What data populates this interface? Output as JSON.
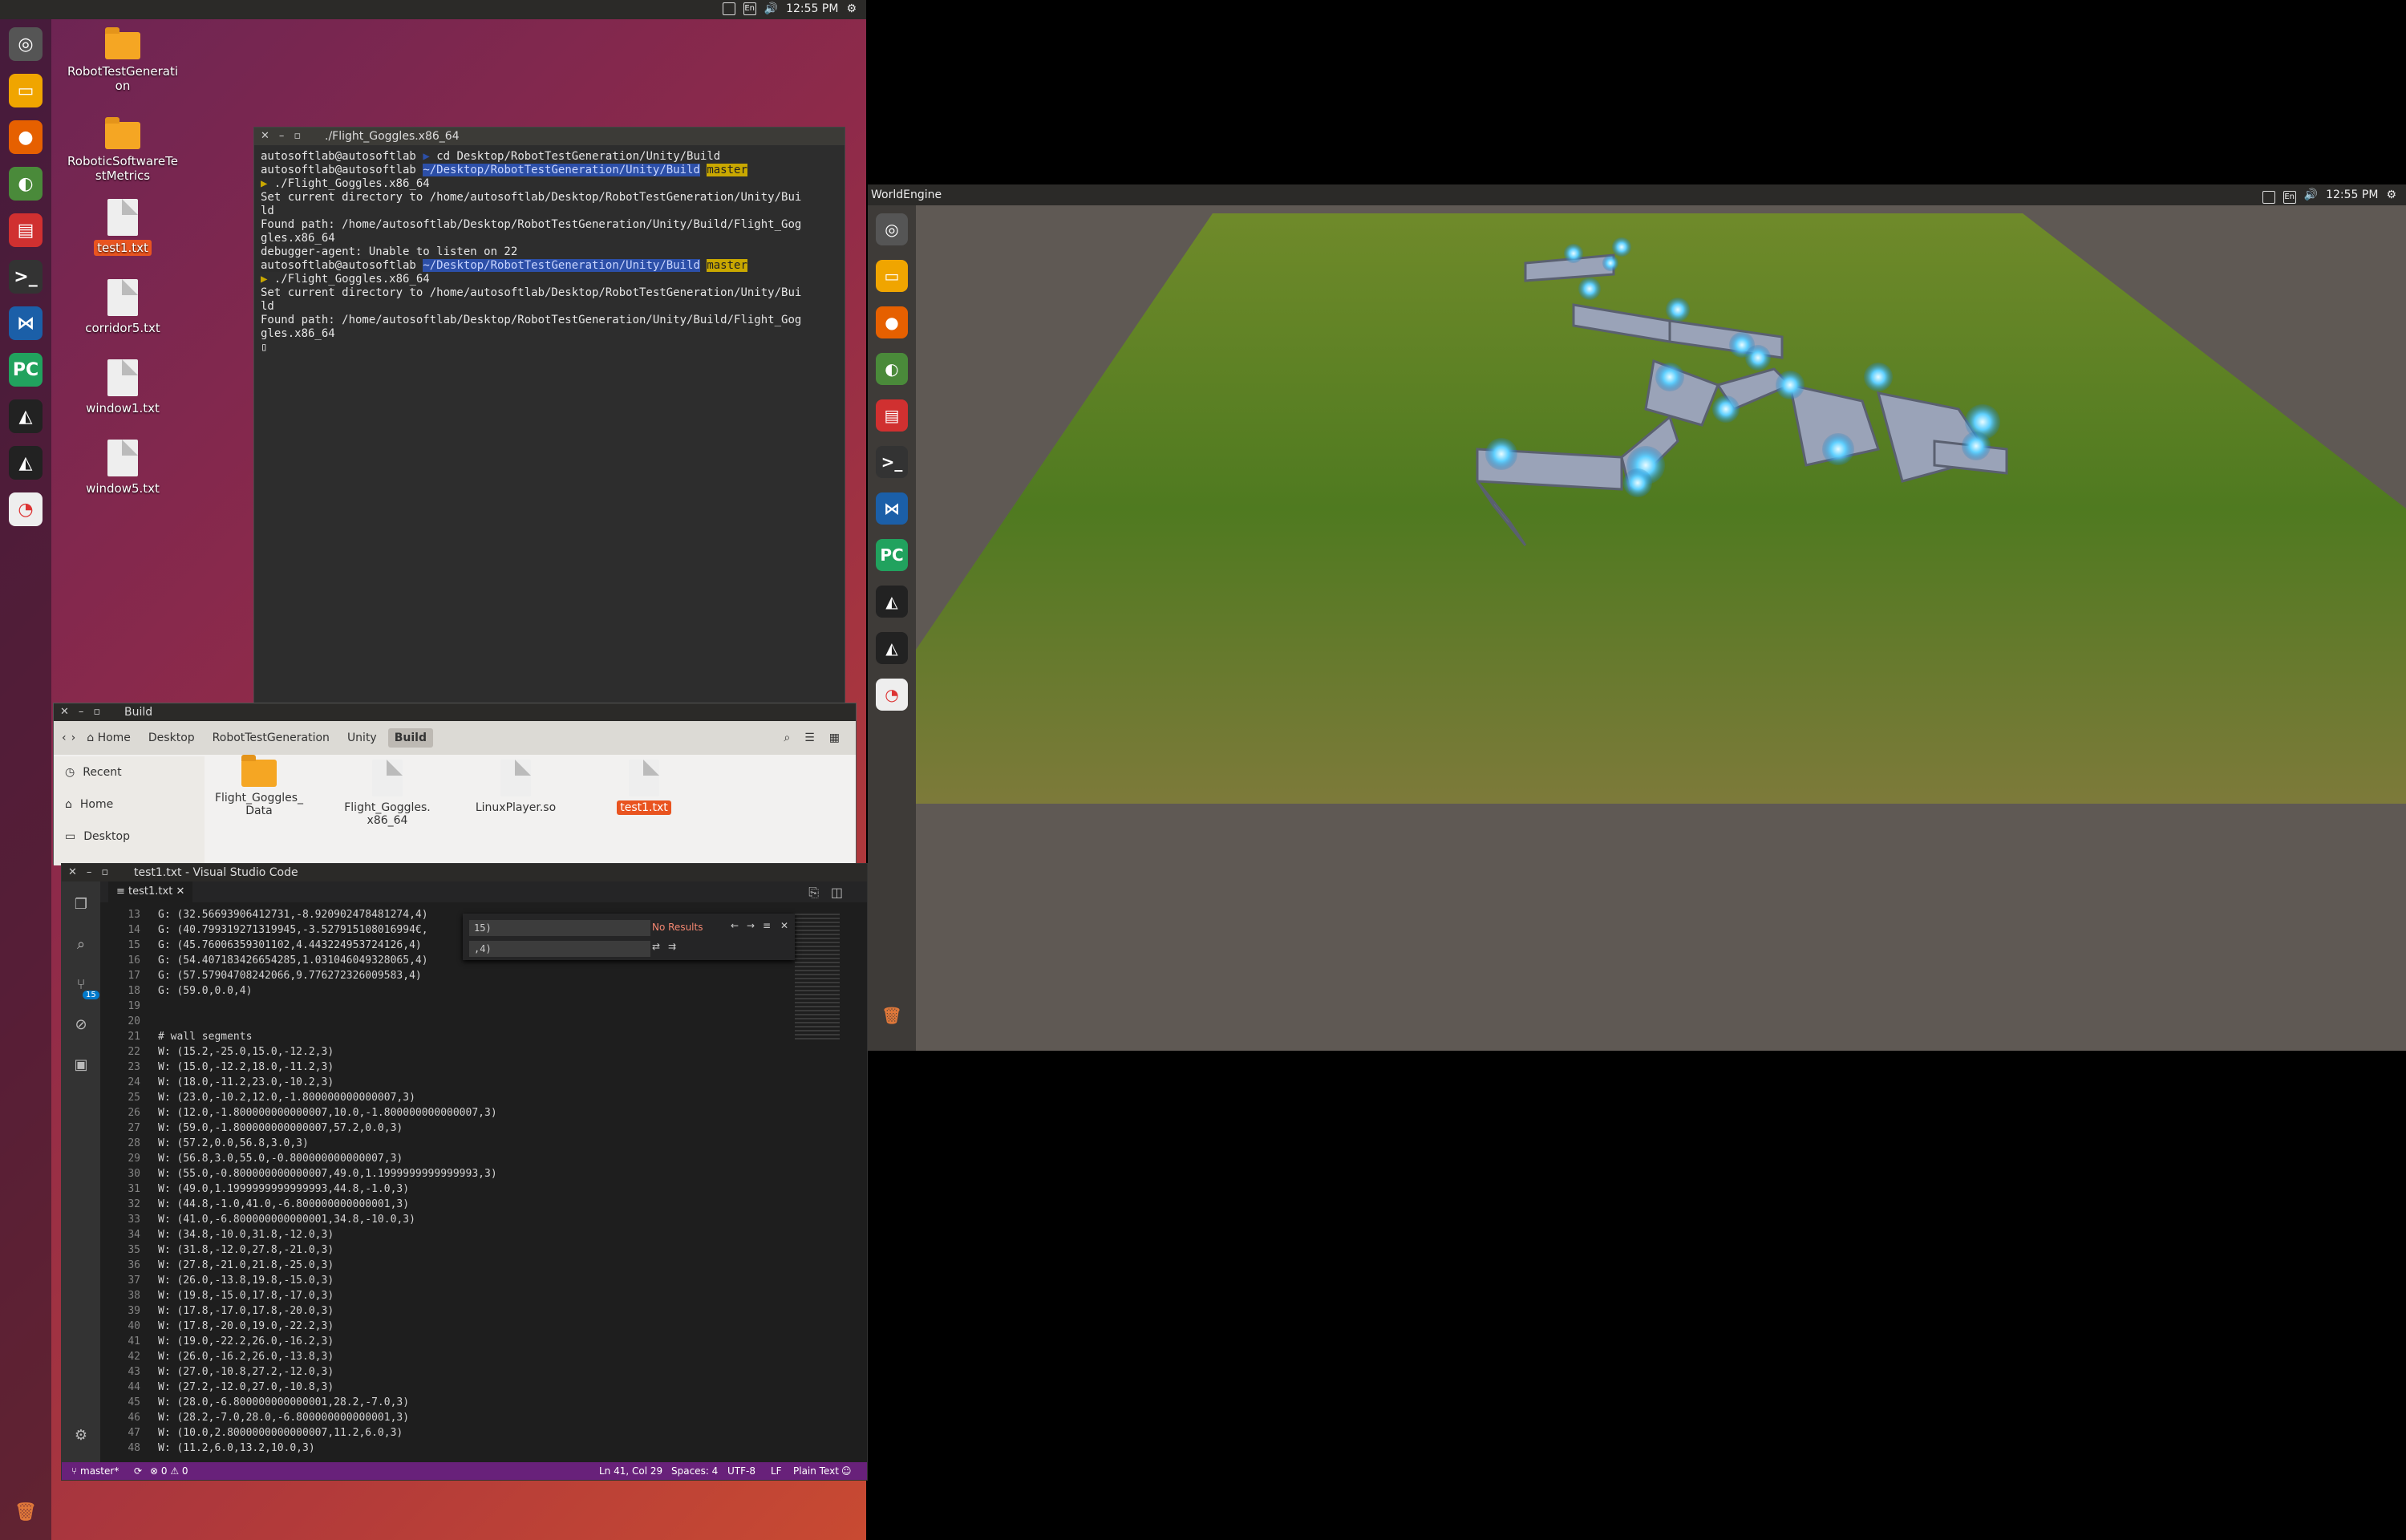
{
  "top_bar": {
    "clock": "12:55 PM",
    "lang": "En"
  },
  "desktop_icons": [
    {
      "label": "RobotTestGenerati\non",
      "type": "folder"
    },
    {
      "label": "RoboticSoftwareTe\nstMetrics",
      "type": "folder"
    },
    {
      "label": "test1.txt",
      "type": "file",
      "selected": true
    },
    {
      "label": "corridor5.txt",
      "type": "file"
    },
    {
      "label": "window1.txt",
      "type": "file"
    },
    {
      "label": "window5.txt",
      "type": "file"
    }
  ],
  "terminal": {
    "title": "./Flight_Goggles.x86_64",
    "prompt_user": "autosoftlab@autosoftlab",
    "prompt_dir": "~/Desktop/RobotTestGeneration/Unity/Build",
    "prompt_git": "master",
    "cmd1": "cd Desktop/RobotTestGeneration/Unity/Build",
    "cmd2": "./Flight_Goggles.x86_64",
    "out1": "Set current directory to /home/autosoftlab/Desktop/RobotTestGeneration/Unity/Bui\nld",
    "out2": "Found path: /home/autosoftlab/Desktop/RobotTestGeneration/Unity/Build/Flight_Gog\ngles.x86_64",
    "out3": "debugger-agent: Unable to listen on 22"
  },
  "files": {
    "title": "Build",
    "breadcrumbs": [
      "Home",
      "Desktop",
      "RobotTestGeneration",
      "Unity",
      "Build"
    ],
    "sidebar": [
      "Recent",
      "Home",
      "Desktop"
    ],
    "items": [
      "Flight_Goggles_\nData",
      "Flight_Goggles.\nx86_64",
      "LinuxPlayer.so",
      "test1.txt"
    ]
  },
  "vscode": {
    "title": "test1.txt - Visual Studio Code",
    "tab": "test1.txt",
    "find_query": "15)",
    "replace_query": ",4)",
    "find_result": "No Results",
    "source_control_badge": "15",
    "lines": [
      {
        "n": "13",
        "t": "G: (32.56693906412731,-8.920902478481274,4)"
      },
      {
        "n": "14",
        "t": "G: (40.799319271319945,-3.527915108016994€,"
      },
      {
        "n": "15",
        "t": "G: (45.76006359301102,4.443224953724126,4)"
      },
      {
        "n": "16",
        "t": "G: (54.407183426654285,1.031046049328065,4)"
      },
      {
        "n": "17",
        "t": "G: (57.57904708242066,9.776272326009583,4)"
      },
      {
        "n": "18",
        "t": "G: (59.0,0.0,4)"
      },
      {
        "n": "19",
        "t": ""
      },
      {
        "n": "20",
        "t": ""
      },
      {
        "n": "21",
        "t": "# wall segments"
      },
      {
        "n": "22",
        "t": "W: (15.2,-25.0,15.0,-12.2,3)"
      },
      {
        "n": "23",
        "t": "W: (15.0,-12.2,18.0,-11.2,3)"
      },
      {
        "n": "24",
        "t": "W: (18.0,-11.2,23.0,-10.2,3)"
      },
      {
        "n": "25",
        "t": "W: (23.0,-10.2,12.0,-1.800000000000007,3)"
      },
      {
        "n": "26",
        "t": "W: (12.0,-1.800000000000007,10.0,-1.800000000000007,3)"
      },
      {
        "n": "27",
        "t": "W: (59.0,-1.800000000000007,57.2,0.0,3)"
      },
      {
        "n": "28",
        "t": "W: (57.2,0.0,56.8,3.0,3)"
      },
      {
        "n": "29",
        "t": "W: (56.8,3.0,55.0,-0.800000000000007,3)"
      },
      {
        "n": "30",
        "t": "W: (55.0,-0.800000000000007,49.0,1.1999999999999993,3)"
      },
      {
        "n": "31",
        "t": "W: (49.0,1.1999999999999993,44.8,-1.0,3)"
      },
      {
        "n": "32",
        "t": "W: (44.8,-1.0,41.0,-6.800000000000001,3)"
      },
      {
        "n": "33",
        "t": "W: (41.0,-6.800000000000001,34.8,-10.0,3)"
      },
      {
        "n": "34",
        "t": "W: (34.8,-10.0,31.8,-12.0,3)"
      },
      {
        "n": "35",
        "t": "W: (31.8,-12.0,27.8,-21.0,3)"
      },
      {
        "n": "36",
        "t": "W: (27.8,-21.0,21.8,-25.0,3)"
      },
      {
        "n": "37",
        "t": "W: (26.0,-13.8,19.8,-15.0,3)"
      },
      {
        "n": "38",
        "t": "W: (19.8,-15.0,17.8,-17.0,3)"
      },
      {
        "n": "39",
        "t": "W: (17.8,-17.0,17.8,-20.0,3)"
      },
      {
        "n": "40",
        "t": "W: (17.8,-20.0,19.0,-22.2,3)"
      },
      {
        "n": "41",
        "t": "W: (19.0,-22.2,26.0,-16.2,3)"
      },
      {
        "n": "42",
        "t": "W: (26.0,-16.2,26.0,-13.8,3)"
      },
      {
        "n": "43",
        "t": "W: (27.0,-10.8,27.2,-12.0,3)"
      },
      {
        "n": "44",
        "t": "W: (27.2,-12.0,27.0,-10.8,3)"
      },
      {
        "n": "45",
        "t": "W: (28.0,-6.800000000000001,28.2,-7.0,3)"
      },
      {
        "n": "46",
        "t": "W: (28.2,-7.0,28.0,-6.800000000000001,3)"
      },
      {
        "n": "47",
        "t": "W: (10.0,2.8000000000000007,11.2,6.0,3)"
      },
      {
        "n": "48",
        "t": "W: (11.2,6.0,13.2,10.0,3)"
      }
    ],
    "status": {
      "branch": "master*",
      "problems": "⊗ 0 ⚠ 0",
      "position": "Ln 41, Col 29",
      "spaces": "Spaces: 4",
      "encoding": "UTF-8",
      "eol": "LF",
      "language": "Plain Text"
    }
  },
  "world_engine": {
    "title": "WorldEngine",
    "clock": "12:55 PM",
    "lang": "En"
  },
  "colors": {
    "ubuntu_orange": "#e95420",
    "vscode_status": "#68217a",
    "sphere_glow": "#5fd0ff"
  }
}
